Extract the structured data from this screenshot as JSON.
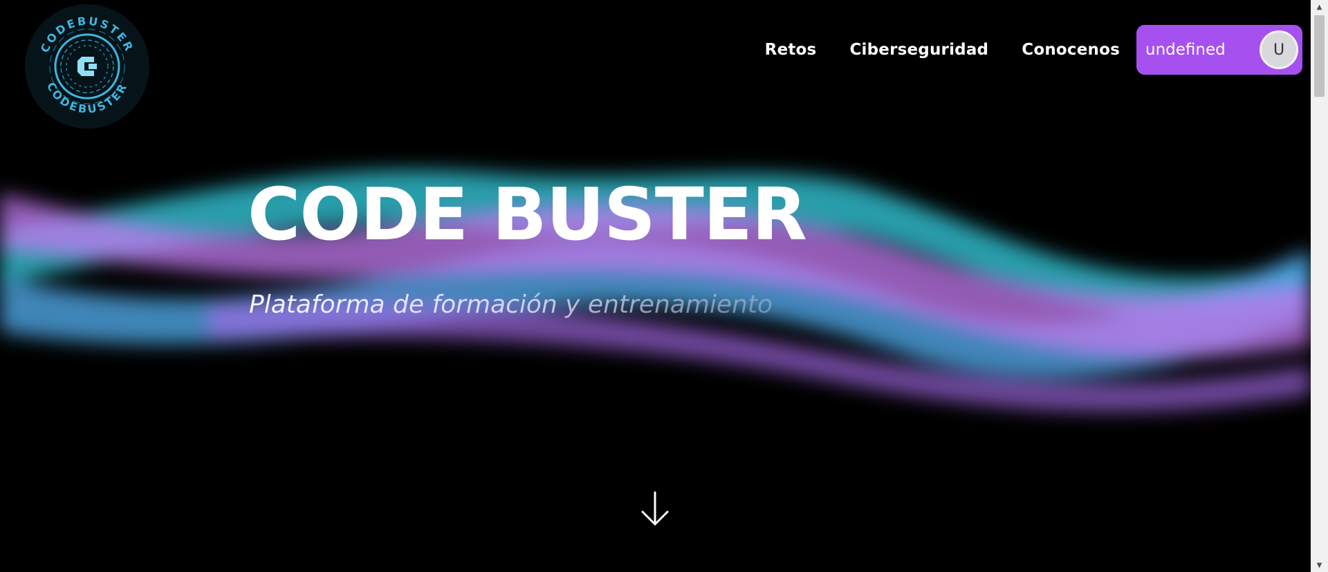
{
  "logo": {
    "text_top": "CODEBUSTER",
    "text_bottom": "CODEBUSTER",
    "icon": "circuit-c-logo-icon",
    "accent": "#3fb7e0"
  },
  "nav": {
    "links": [
      "Retos",
      "Ciberseguridad",
      "Conocenos"
    ],
    "user_name": "undefined",
    "avatar_initial": "U",
    "pill_color": "#a650f0"
  },
  "hero": {
    "title": "CODE BUSTER",
    "subtitle": "Plataforma de formación y entrenamiento",
    "scroll_icon": "arrow-down-icon"
  },
  "colors": {
    "background": "#000000",
    "wave_teal": "#2fb9c8",
    "wave_blue": "#4fa8e6",
    "wave_pink": "#c47af0"
  }
}
